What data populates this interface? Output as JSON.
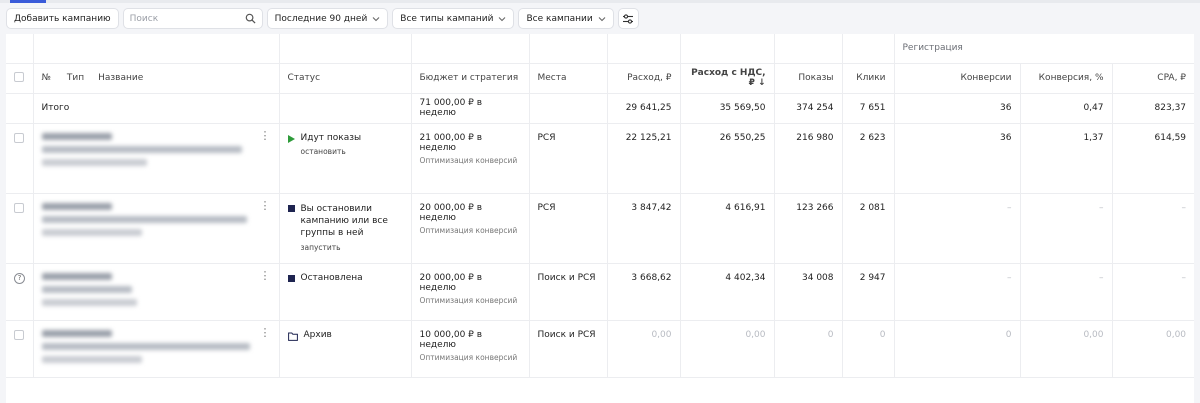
{
  "toolbar": {
    "add_campaign": "Добавить кампанию",
    "search_placeholder": "Поиск",
    "period": "Последние 90 дней",
    "campaign_types": "Все типы кампаний",
    "campaigns": "Все кампании"
  },
  "table": {
    "group_header": "Регистрация",
    "headers": {
      "num": "№",
      "type": "Тип",
      "name": "Название",
      "status": "Статус",
      "budget": "Бюджет и стратегия",
      "places": "Места",
      "spend": "Расход, ₽",
      "spend_vat": "Расход с НДС, ₽ ↓",
      "impressions": "Показы",
      "clicks": "Клики",
      "conversions": "Конверсии",
      "conv_rate": "Конверсия, %",
      "cpa": "CPA, ₽"
    },
    "total": {
      "label": "Итого",
      "budget": "71 000,00 ₽ в неделю",
      "spend": "29 641,25",
      "spend_vat": "35 569,50",
      "impressions": "374 254",
      "clicks": "7 651",
      "conversions": "36",
      "conv_rate": "0,47",
      "cpa": "823,37"
    },
    "rows": [
      {
        "status": "Идут показы",
        "action": "остановить",
        "budget": "21 000,00 ₽ в неделю",
        "strategy": "Оптимизация конверсий",
        "places": "РСЯ",
        "spend": "22 125,21",
        "spend_vat": "26 550,25",
        "impressions": "216 980",
        "clicks": "2 623",
        "conversions": "36",
        "conv_rate": "1,37",
        "cpa": "614,59"
      },
      {
        "status": "Вы остановили кампанию или все группы в ней",
        "action": "запустить",
        "budget": "20 000,00 ₽ в неделю",
        "strategy": "Оптимизация конверсий",
        "places": "РСЯ",
        "spend": "3 847,42",
        "spend_vat": "4 616,91",
        "impressions": "123 266",
        "clicks": "2 081",
        "conversions": "–",
        "conv_rate": "–",
        "cpa": "–"
      },
      {
        "status": "Остановлена",
        "budget": "20 000,00 ₽ в неделю",
        "strategy": "Оптимизация конверсий",
        "places": "Поиск и РСЯ",
        "spend": "3 668,62",
        "spend_vat": "4 402,34",
        "impressions": "34 008",
        "clicks": "2 947",
        "conversions": "–",
        "conv_rate": "–",
        "cpa": "–"
      },
      {
        "status": "Архив",
        "budget": "10 000,00 ₽ в неделю",
        "strategy": "Оптимизация конверсий",
        "places": "Поиск и РСЯ",
        "spend": "0,00",
        "spend_vat": "0,00",
        "impressions": "0",
        "clicks": "0",
        "conversions": "0",
        "conv_rate": "0,00",
        "cpa": "0,00"
      }
    ]
  },
  "colors": {
    "accent": "#3a5bd9",
    "running": "#2e9b3a",
    "stopped": "#1e2450"
  }
}
